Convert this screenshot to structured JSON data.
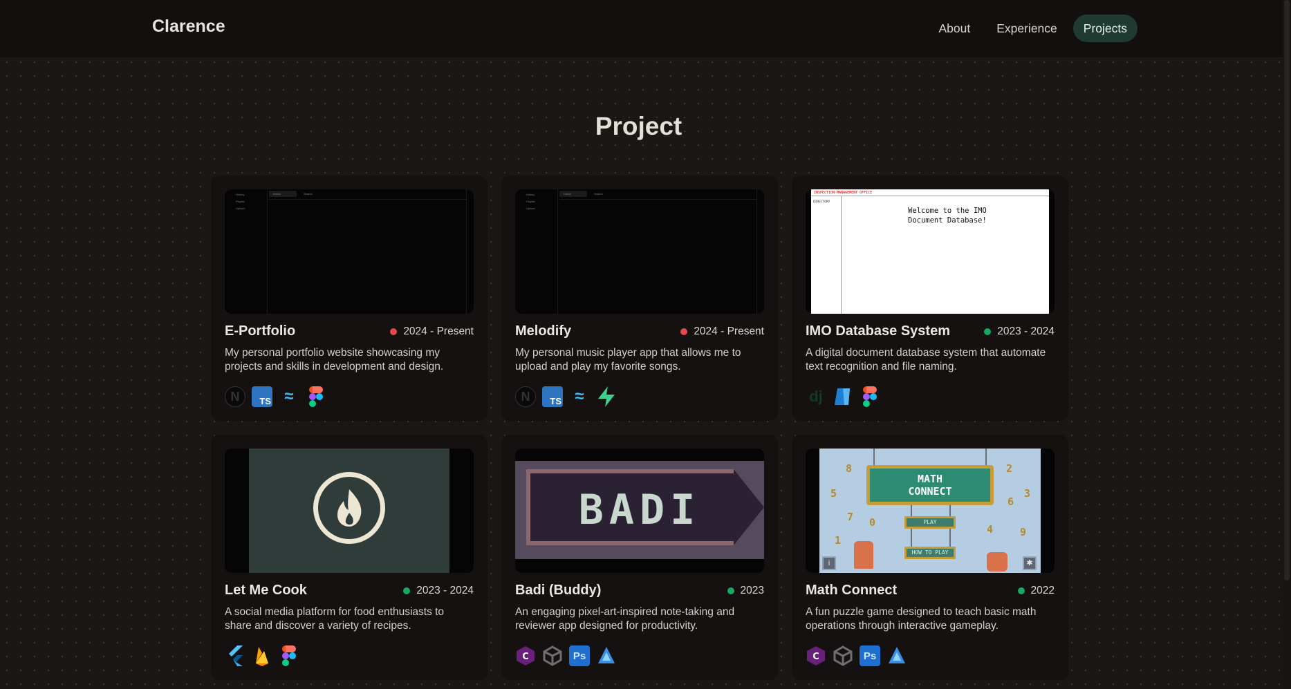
{
  "header": {
    "brand": "Clarence",
    "nav": [
      {
        "label": "About",
        "active": false
      },
      {
        "label": "Experience",
        "active": false
      },
      {
        "label": "Projects",
        "active": true
      }
    ]
  },
  "main": {
    "title": "Project",
    "projects": [
      {
        "title": "E-Portfolio",
        "date": "2024 - Present",
        "status_color": "#e5484d",
        "description": "My personal portfolio website showcasing my projects and skills in development and design.",
        "tech_icons": [
          "nextjs-icon",
          "typescript-icon",
          "tailwind-icon",
          "figma-icon"
        ],
        "thumb": {
          "side_items": [
            "History",
            "Playlist",
            "Upload"
          ],
          "tabs": [
            "Home",
            "Search"
          ]
        }
      },
      {
        "title": "Melodify",
        "date": "2024 - Present",
        "status_color": "#e5484d",
        "description": "My personal music player app that allows me to upload and play my favorite songs.",
        "tech_icons": [
          "nextjs-icon",
          "typescript-icon",
          "tailwind-icon",
          "supabase-icon"
        ],
        "thumb": {
          "side_items": [
            "History",
            "Playlist",
            "Upload"
          ],
          "tabs": [
            "Home",
            "Search"
          ]
        }
      },
      {
        "title": "IMO Database System",
        "date": "2023 - 2024",
        "status_color": "#17a864",
        "description": "A digital document database system that automate text recognition and file naming.",
        "tech_icons": [
          "django-icon",
          "azure-icon",
          "figma-icon"
        ],
        "thumb": {
          "header": "INSPECTION MANAGEMENT OFFICE",
          "side": "DIRECTORY",
          "welcome_line1": "Welcome to the IMO",
          "welcome_line2": "Document Database!"
        }
      },
      {
        "title": "Let Me Cook",
        "date": "2023 - 2024",
        "status_color": "#17a864",
        "description": "A social media platform for food enthusiasts to share and discover a variety of recipes.",
        "tech_icons": [
          "flutter-icon",
          "firebase-icon",
          "figma-icon"
        ],
        "thumb": {}
      },
      {
        "title": "Badi (Buddy)",
        "date": "2023",
        "status_color": "#17a864",
        "description": "An engaging pixel-art-inspired note-taking and reviewer app designed for productivity.",
        "tech_icons": [
          "csharp-icon",
          "unity-icon",
          "photoshop-icon",
          "aseprite-icon"
        ],
        "thumb": {
          "logo_text": "BADI"
        }
      },
      {
        "title": "Math Connect",
        "date": "2022",
        "status_color": "#17a864",
        "description": "A fun puzzle game designed to teach basic math operations through interactive gameplay.",
        "tech_icons": [
          "csharp-icon",
          "unity-icon",
          "photoshop-icon",
          "aseprite-icon"
        ],
        "thumb": {
          "sign_line1": "MATH",
          "sign_line2": "CONNECT",
          "btn1": "PLAY",
          "btn2": "HOW TO PLAY"
        }
      }
    ]
  }
}
